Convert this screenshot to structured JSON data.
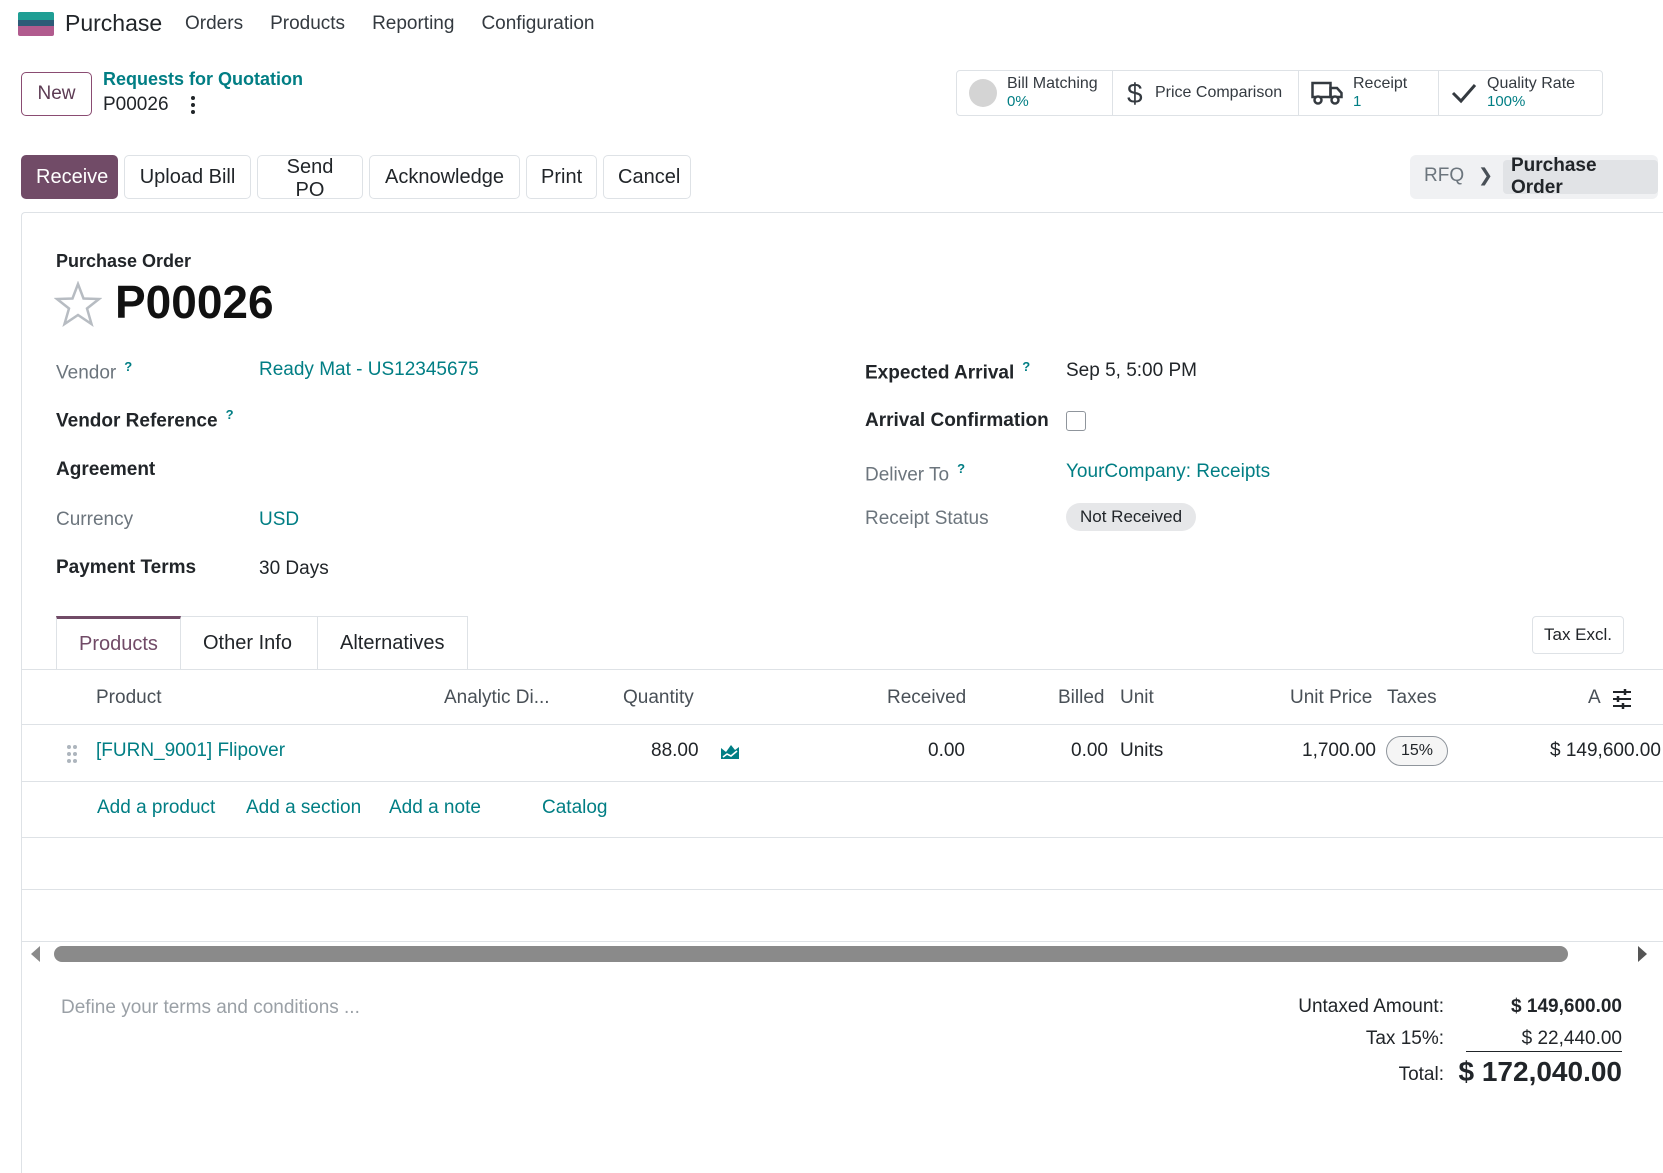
{
  "app": {
    "name": "Purchase",
    "menu": [
      "Orders",
      "Products",
      "Reporting",
      "Configuration"
    ]
  },
  "control": {
    "new_label": "New",
    "breadcrumb": "Requests for Quotation",
    "record": "P00026"
  },
  "stats": {
    "bill_matching": {
      "label": "Bill Matching",
      "value": "0%"
    },
    "price_comparison": {
      "label": "Price Comparison"
    },
    "receipt": {
      "label": "Receipt",
      "value": "1"
    },
    "quality_rate": {
      "label": "Quality Rate",
      "value": "100%"
    }
  },
  "actions": {
    "receive": "Receive",
    "upload_bill": "Upload Bill",
    "send_po": "Send PO",
    "acknowledge": "Acknowledge",
    "print": "Print",
    "cancel": "Cancel"
  },
  "status": {
    "rfq": "RFQ",
    "current": "Purchase Order"
  },
  "form": {
    "type_label": "Purchase Order",
    "title": "P00026",
    "help_mark": "?",
    "vendor_label": "Vendor",
    "vendor_value": "Ready Mat - US12345675",
    "vendor_ref_label": "Vendor Reference",
    "agreement_label": "Agreement",
    "currency_label": "Currency",
    "currency_value": "USD",
    "payment_terms_label": "Payment Terms",
    "payment_terms_value": "30 Days",
    "expected_arrival_label": "Expected Arrival",
    "expected_arrival_value": "Sep 5, 5:00 PM",
    "arrival_conf_label": "Arrival Confirmation",
    "deliver_to_label": "Deliver To",
    "deliver_to_value": "YourCompany: Receipts",
    "receipt_status_label": "Receipt Status",
    "receipt_status_value": "Not Received"
  },
  "tabs": [
    "Products",
    "Other Info",
    "Alternatives"
  ],
  "tax_toggle": "Tax Excl.",
  "table": {
    "headers": {
      "product": "Product",
      "analytic": "Analytic Di...",
      "quantity": "Quantity",
      "received": "Received",
      "billed": "Billed",
      "unit": "Unit",
      "unit_price": "Unit Price",
      "taxes": "Taxes",
      "amount": "A"
    },
    "rows": [
      {
        "product": "[FURN_9001] Flipover",
        "quantity": "88.00",
        "received": "0.00",
        "billed": "0.00",
        "unit": "Units",
        "unit_price": "1,700.00",
        "taxes": "15%",
        "amount": "$ 149,600.00"
      }
    ],
    "add_links": {
      "product": "Add a product",
      "section": "Add a section",
      "note": "Add a note",
      "catalog": "Catalog"
    }
  },
  "terms_placeholder": "Define your terms and conditions ...",
  "totals": {
    "untaxed_label": "Untaxed Amount:",
    "untaxed_value": "$ 149,600.00",
    "tax_label": "Tax 15%:",
    "tax_value": "$ 22,440.00",
    "total_label": "Total:",
    "total_value": "$ 172,040.00"
  },
  "colors": {
    "brand": "#714b67",
    "link": "#017e84"
  }
}
